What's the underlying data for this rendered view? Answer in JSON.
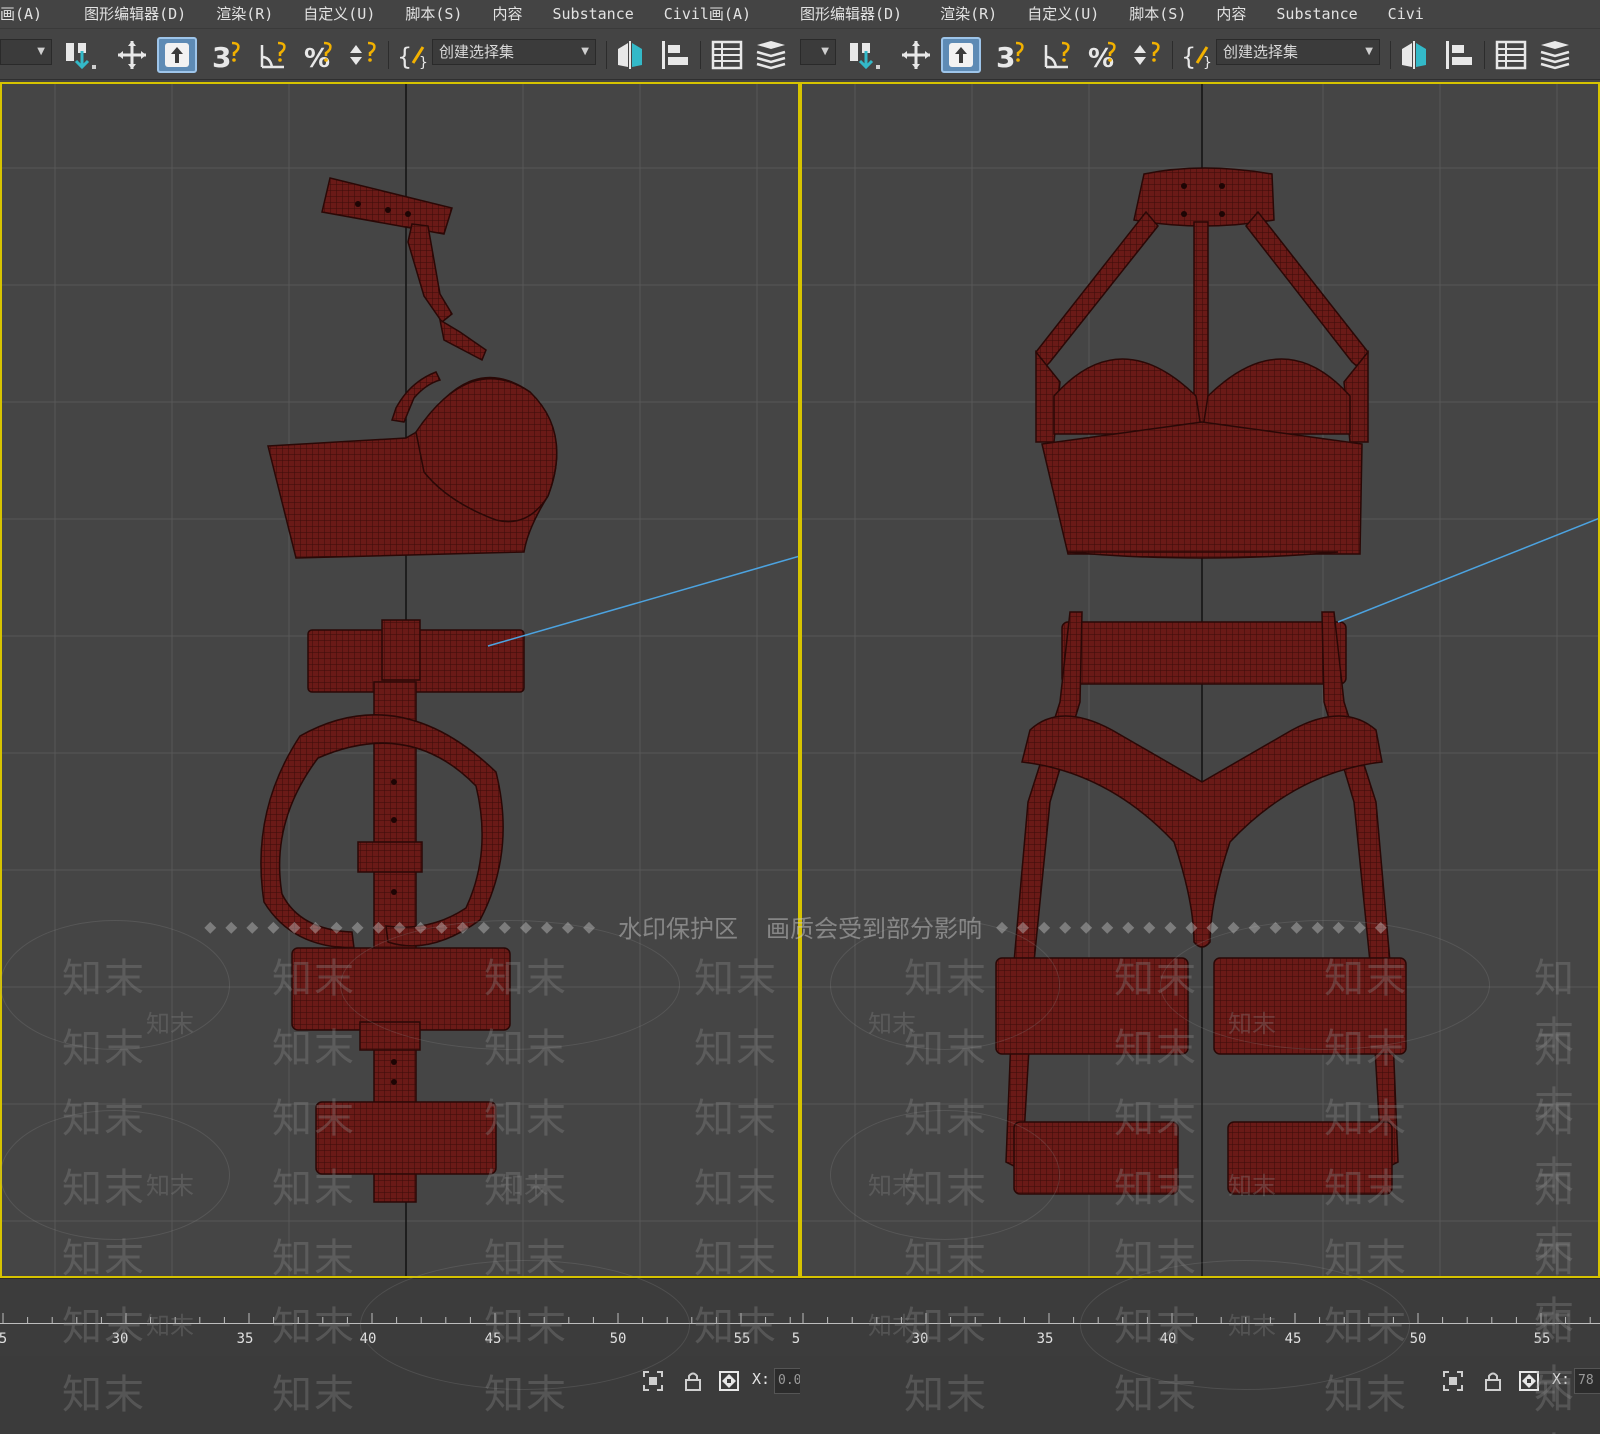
{
  "menu": {
    "items": [
      "画(A)",
      "图形编辑器(D)",
      "渲染(R)",
      "自定义(U)",
      "脚本(S)",
      "内容",
      "Substance",
      "Civil画(A)"
    ],
    "items_right": [
      "图形编辑器(D)",
      "渲染(R)",
      "自定义(U)",
      "脚本(S)",
      "内容",
      "Substance",
      "Civi"
    ]
  },
  "toolbar": {
    "selection_set_placeholder": "创建选择集",
    "icons": [
      "select-and-link-icon",
      "move-icon",
      "select-object-icon",
      "snap-3d-icon",
      "angle-snap-icon",
      "percent-snap-icon",
      "spinner-snap-icon",
      "edit-named-selection-icon",
      "mirror-icon",
      "align-icon",
      "scene-explorer-icon",
      "layer-explorer-icon"
    ]
  },
  "viewports": {
    "left_view": "side",
    "right_view": "front",
    "mesh_color": "#6a1a17",
    "border_color": "#d6c300",
    "grid_color": "#5a5a5a"
  },
  "timeline": {
    "ticks_left": [
      "5",
      "30",
      "35",
      "40",
      "45",
      "50",
      "55",
      "5"
    ],
    "ticks_right": [
      "30",
      "35",
      "40",
      "45",
      "50",
      "55"
    ]
  },
  "status": {
    "x_label": "X:",
    "x_value_left": "0.0",
    "x_value_right": "78"
  },
  "watermark": {
    "banner_text_1": "水印保护区",
    "banner_text_2": "画质会受到部分影响",
    "brand": "知末"
  }
}
